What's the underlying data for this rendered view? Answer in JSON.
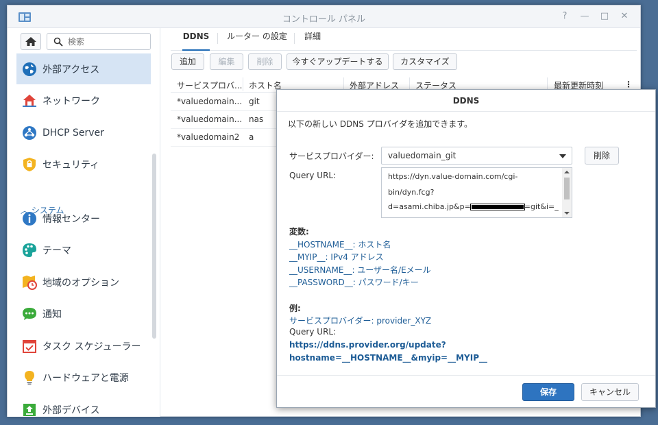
{
  "window": {
    "title": "コントロール パネル",
    "controls": [
      "?",
      "—",
      "□",
      "✕"
    ]
  },
  "sidebar": {
    "search_placeholder": "検索",
    "section_system": "システム",
    "items": [
      {
        "label": "外部アクセス",
        "icon": "globe-icon",
        "active": true
      },
      {
        "label": "ネットワーク",
        "icon": "network-house-icon"
      },
      {
        "label": "DHCP Server",
        "icon": "dhcp-icon"
      },
      {
        "label": "セキュリティ",
        "icon": "shield-icon"
      },
      {
        "label": "情報センター",
        "icon": "info-icon"
      },
      {
        "label": "テーマ",
        "icon": "palette-icon"
      },
      {
        "label": "地域のオプション",
        "icon": "region-clock-icon"
      },
      {
        "label": "通知",
        "icon": "chat-bubble-icon"
      },
      {
        "label": "タスク スケジューラー",
        "icon": "calendar-check-icon"
      },
      {
        "label": "ハードウェアと電源",
        "icon": "lightbulb-icon"
      },
      {
        "label": "外部デバイス",
        "icon": "upload-icon"
      }
    ]
  },
  "tabs": [
    "DDNS",
    "ルーター の設定",
    "詳細"
  ],
  "toolbar": {
    "add": "追加",
    "edit": "編集",
    "delete": "削除",
    "update_now": "今すぐアップデートする",
    "customize": "カスタマイズ"
  },
  "table": {
    "columns": [
      "サービスプロバ...",
      "ホスト名",
      "外部アドレス",
      "ステータス",
      "最新更新時刻"
    ],
    "rows": [
      [
        "*valuedomain...",
        "git"
      ],
      [
        "*valuedomain...",
        "nas"
      ],
      [
        "*valuedomain2",
        "a"
      ]
    ]
  },
  "dialog": {
    "title": "DDNS",
    "intro": "以下の新しい DDNS プロバイダを追加できます。",
    "provider_label": "サービスプロバイダー:",
    "provider_value": "valuedomain_git",
    "delete_label": "削除",
    "query_url_label": "Query URL:",
    "query_url_lines": [
      "https://dyn.value-domain.com/cgi-",
      "bin/dyn.fcg?",
      "d=asami.chiba.jp&p=",
      "=git&i=_"
    ],
    "vars_title": "変数:",
    "vars": [
      "__HOSTNAME__: ホスト名",
      "__MYIP__: IPv4 アドレス",
      "__USERNAME__: ユーザー名/Eメール",
      "__PASSWORD__: パスワード/キー"
    ],
    "example_title": "例:",
    "example_provider": "サービスプロバイダー: provider_XYZ",
    "example_query_label": "Query URL:",
    "example_url_line1": "https://ddns.provider.org/update?",
    "example_url_line2": "hostname=__HOSTNAME__&myip=__MYIP__",
    "save": "保存",
    "cancel": "キャンセル"
  },
  "colors": {
    "accent": "#2e74c0",
    "link_blue": "#1d5c96",
    "active_nav": "#d6e4f4",
    "desktop": "#4a6d94"
  }
}
